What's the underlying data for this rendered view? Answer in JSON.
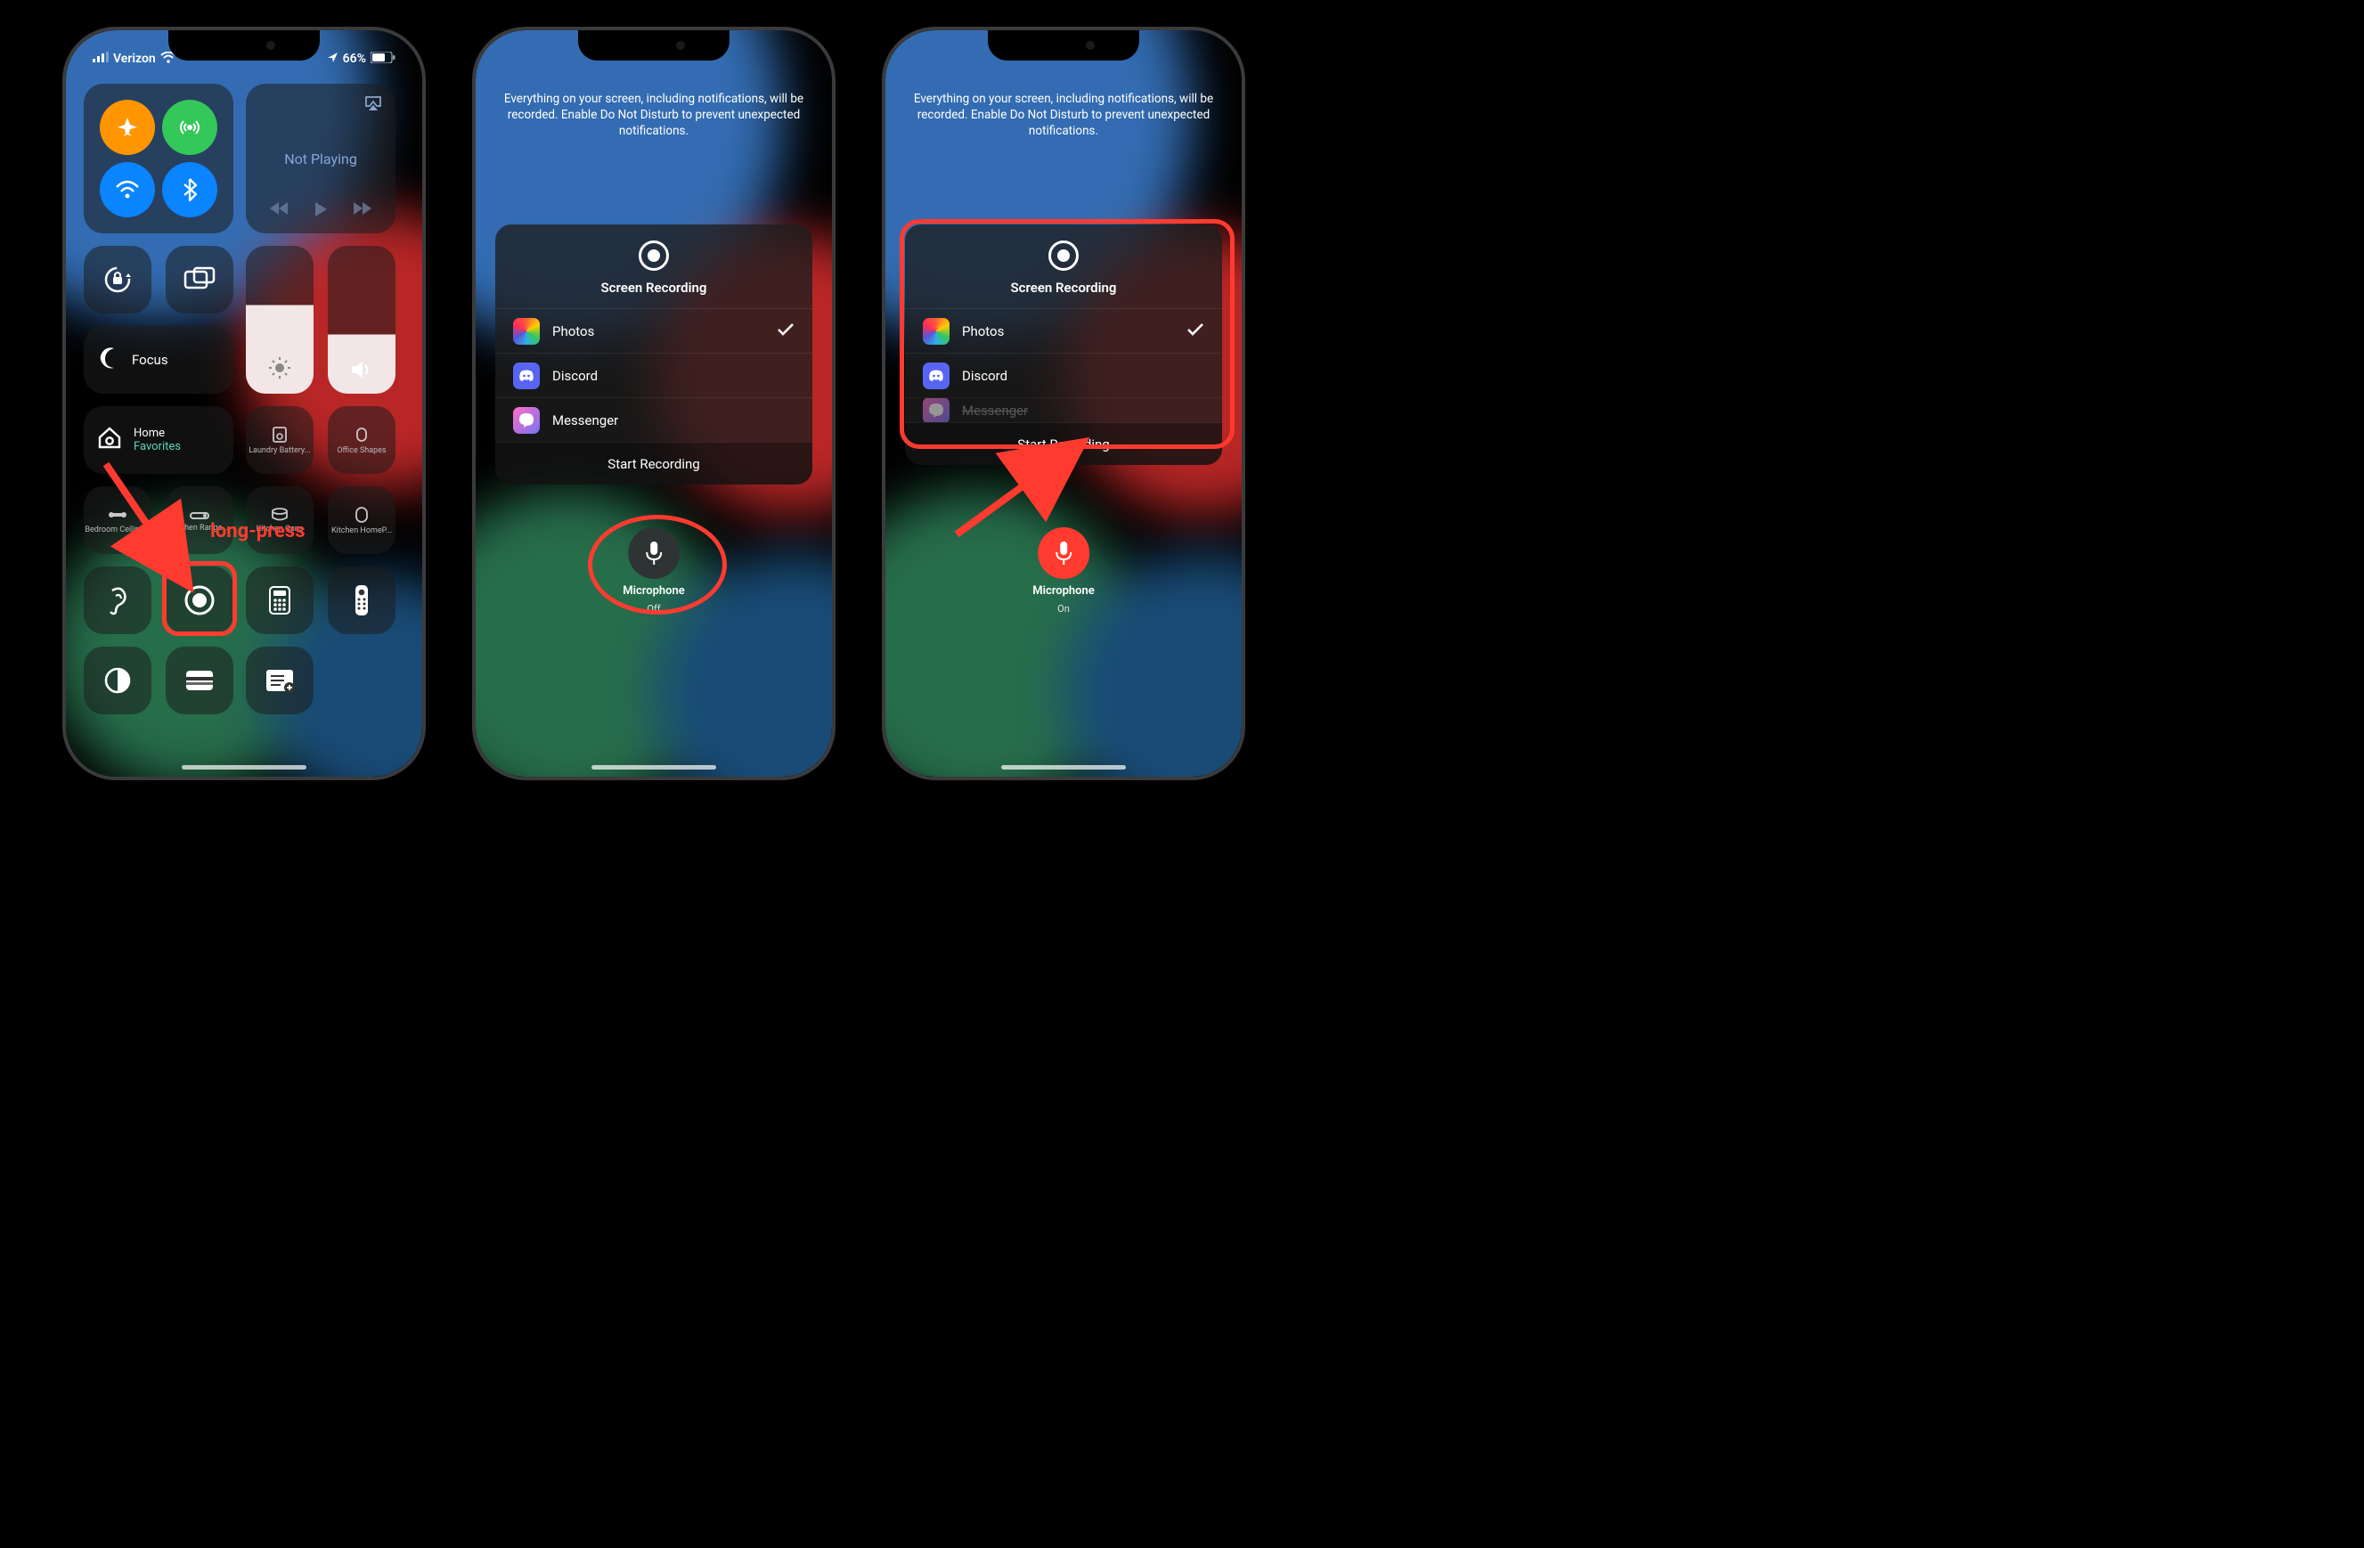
{
  "p1": {
    "carrier": "Verizon",
    "battery": "66%",
    "not_playing": "Not Playing",
    "focus": "Focus",
    "home": "Home",
    "favorites": "Favorites",
    "laundry": "Laundry Battery...",
    "office": "Office Shapes",
    "bedroom": "Bedroom Ceiling...",
    "range": "Kitchen Range...",
    "cans": "Kitchen Cans",
    "homepod": "Kitchen HomeP...",
    "annot": "long-press"
  },
  "msg": "Everything on your screen, including notifications, will be recorded. Enable Do Not Disturb to prevent unexpected notifications.",
  "card": {
    "title": "Screen Recording",
    "photos": "Photos",
    "discord": "Discord",
    "messenger": "Messenger",
    "start": "Start Recording"
  },
  "mic": {
    "label": "Microphone",
    "off": "Off",
    "on": "On"
  }
}
